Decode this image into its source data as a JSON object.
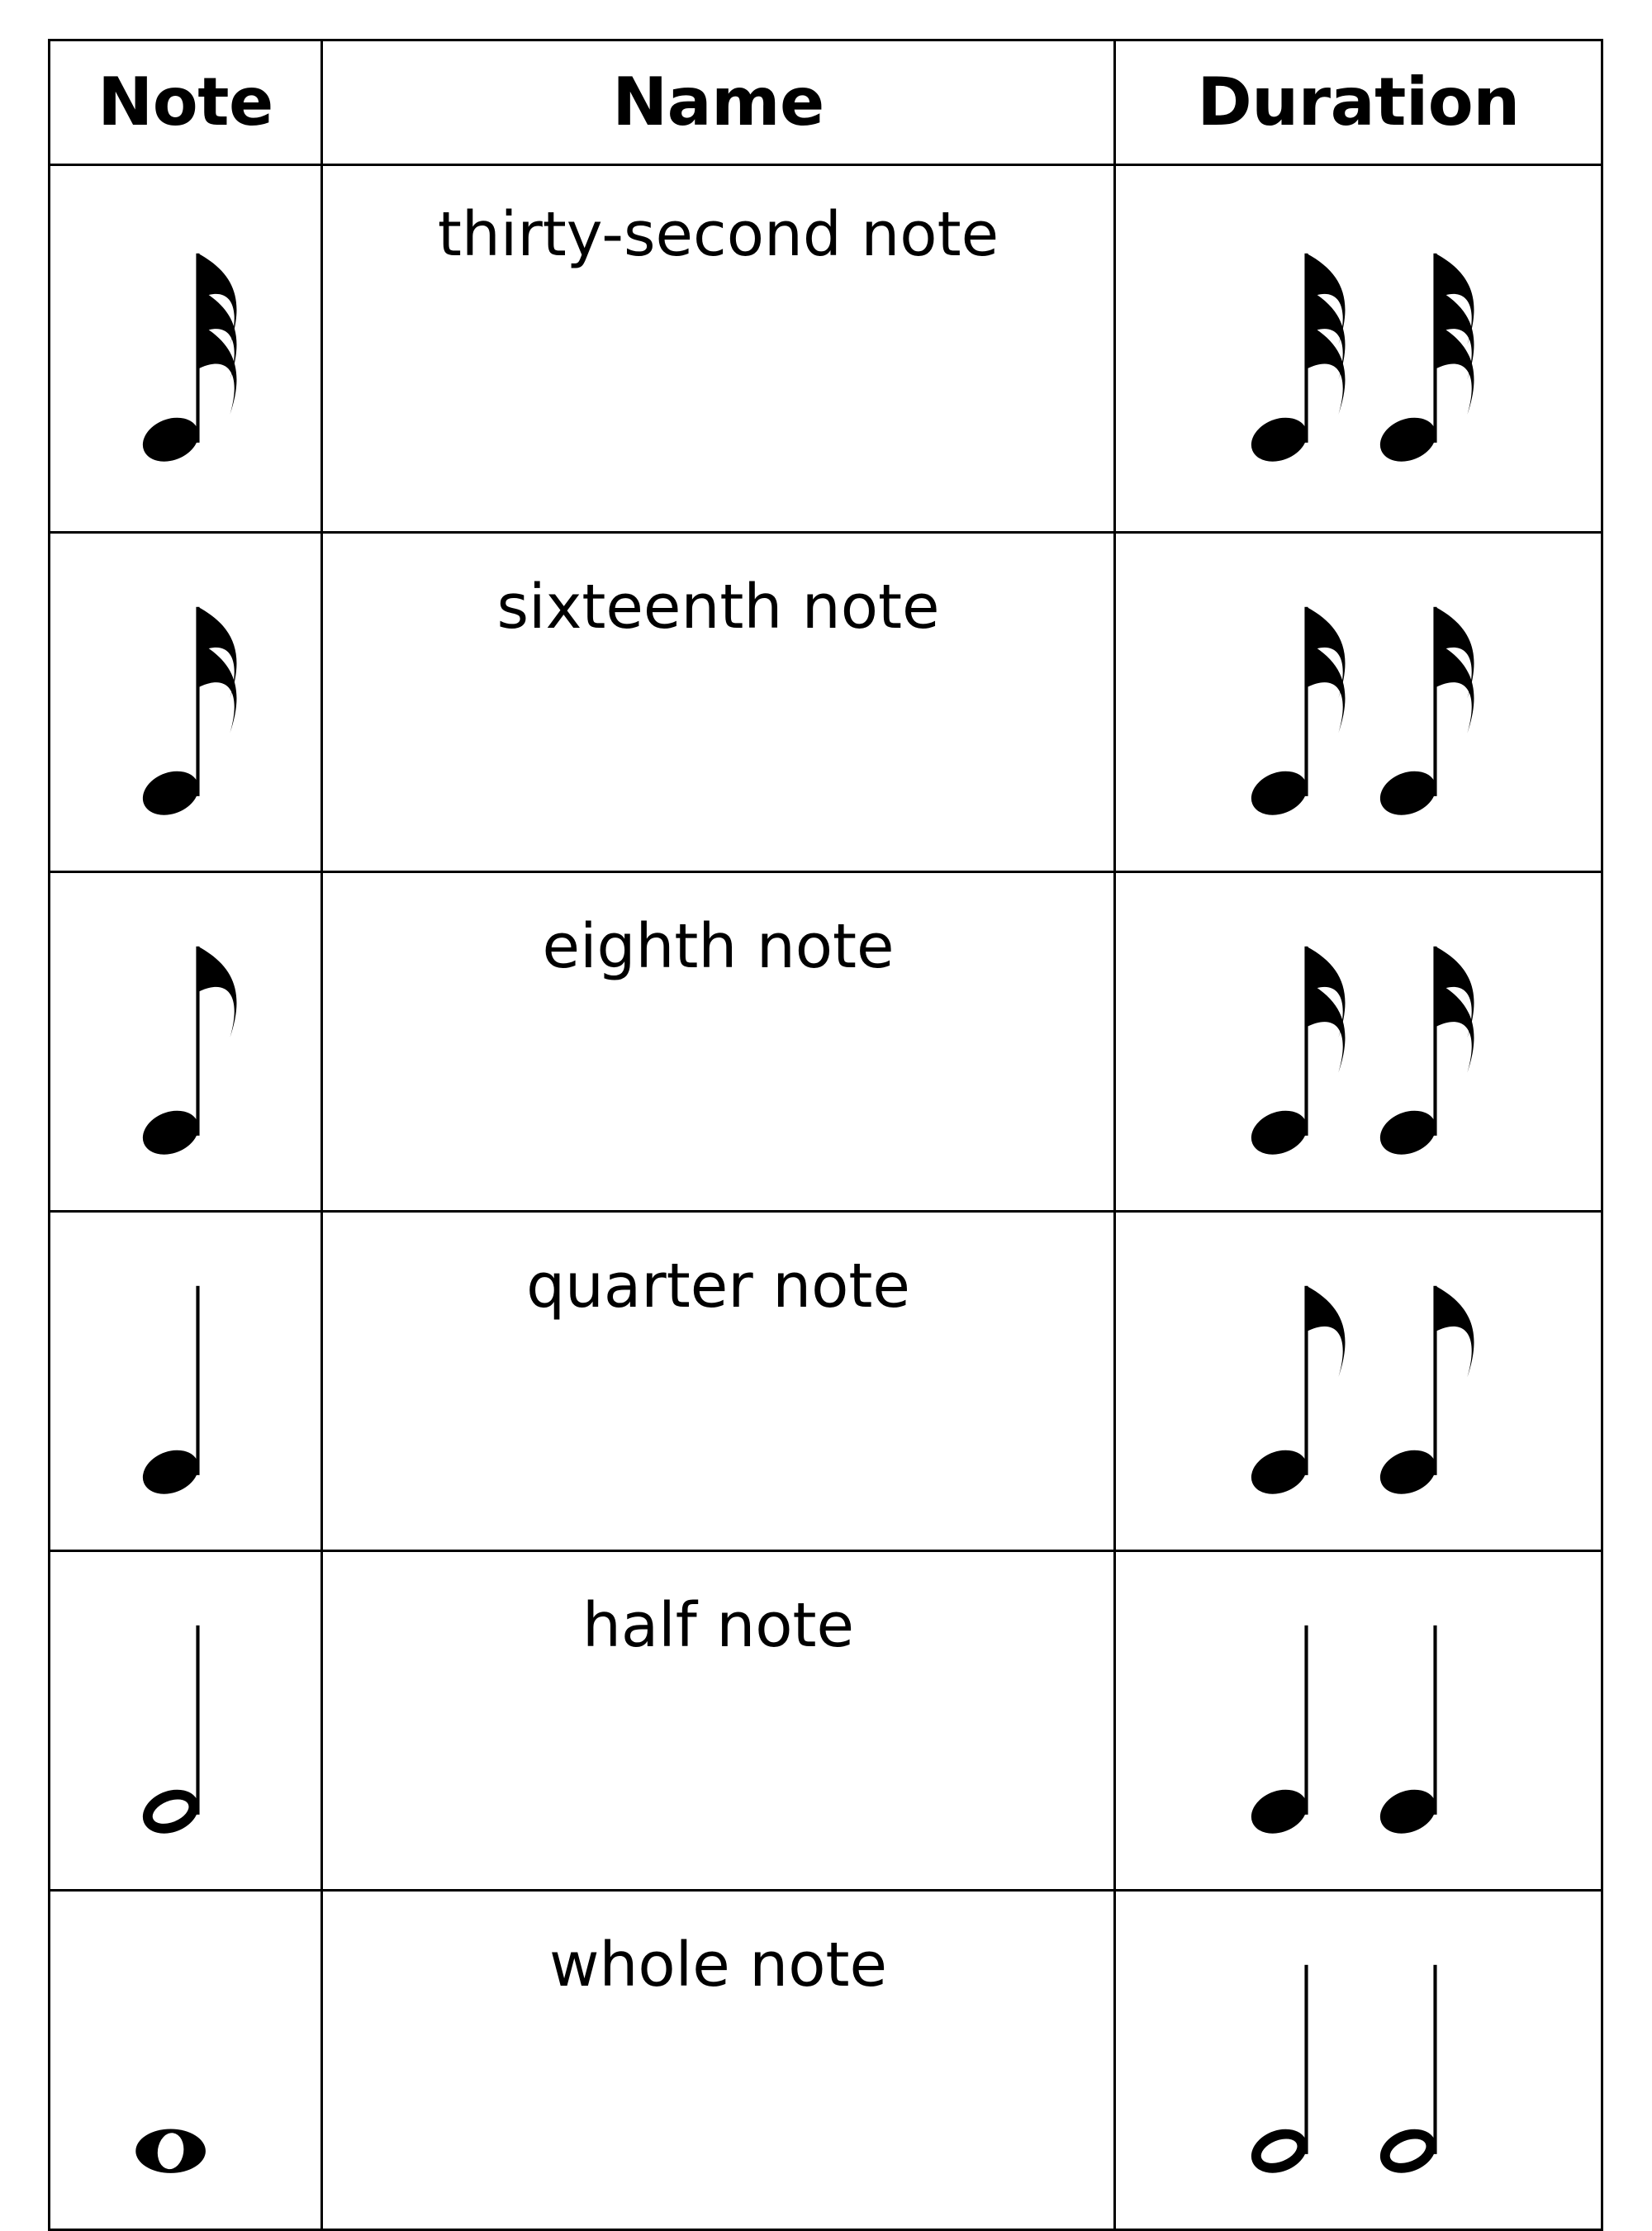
{
  "table": {
    "headers": [
      {
        "id": "note",
        "label": "Note"
      },
      {
        "id": "name",
        "label": "Name"
      },
      {
        "id": "duration",
        "label": "Duration"
      }
    ],
    "rows": [
      {
        "name": "thirty-second note",
        "note_symbol": "thirty-second-note",
        "note_flags": 3,
        "note_head": "filled",
        "duration_symbol": "two-sixty-fourth-notes",
        "duration_count": 2,
        "duration_flags": 3,
        "duration_head": "filled"
      },
      {
        "name": "sixteenth note",
        "note_symbol": "sixteenth-note",
        "note_flags": 2,
        "note_head": "filled",
        "duration_symbol": "two-thirty-second-notes",
        "duration_count": 2,
        "duration_flags": 2,
        "duration_head": "filled"
      },
      {
        "name": "eighth note",
        "note_symbol": "eighth-note",
        "note_flags": 1,
        "note_head": "filled",
        "duration_symbol": "two-sixteenth-notes",
        "duration_count": 2,
        "duration_flags": 2,
        "duration_head": "filled"
      },
      {
        "name": "quarter note",
        "note_symbol": "quarter-note",
        "note_flags": 0,
        "note_head": "filled",
        "duration_symbol": "two-eighth-notes",
        "duration_count": 2,
        "duration_flags": 1,
        "duration_head": "filled"
      },
      {
        "name": "half note",
        "note_symbol": "half-note",
        "note_flags": 0,
        "note_head": "hollow",
        "duration_symbol": "two-quarter-notes",
        "duration_count": 2,
        "duration_flags": 0,
        "duration_head": "filled"
      },
      {
        "name": "whole note",
        "note_symbol": "whole-note",
        "note_flags": 0,
        "note_head": "hollow-no-stem",
        "duration_symbol": "two-half-notes",
        "duration_count": 2,
        "duration_flags": 0,
        "duration_head": "hollow"
      }
    ]
  },
  "colors": {
    "ink": "#000000",
    "paper": "#ffffff"
  }
}
